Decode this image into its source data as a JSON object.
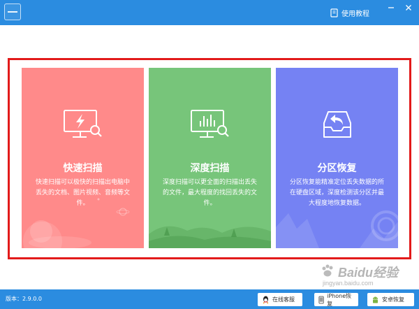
{
  "titlebar": {
    "tutorial_label": "使用教程",
    "icons": [
      "app-logo",
      "book-icon",
      "minimize-icon",
      "close-icon"
    ]
  },
  "cards": [
    {
      "title": "快速扫描",
      "description": "快速扫描可以极快的扫描出电脑中丢失的文档、图片视频、音频等文件。",
      "icon": "monitor-lightning-search-icon",
      "color": "#ff8a8a"
    },
    {
      "title": "深度扫描",
      "description": "深度扫描可以更全面的扫描出丢失的文件，最大程度的找回丢失的文件。",
      "icon": "monitor-chart-search-icon",
      "color": "#77c57a"
    },
    {
      "title": "分区恢复",
      "description": "分区恢复能精准定位丢失数据的所在硬盘区域，深度检测该分区并最大程度地恢复数据。",
      "icon": "tray-return-icon",
      "color": "#7582f3"
    }
  ],
  "bottombar": {
    "version": "版本：2.9.0.0",
    "buttons": [
      {
        "label": "在线客服",
        "icon": "qq-icon"
      },
      {
        "label": "iPhone恢复",
        "icon": "iphone-icon"
      },
      {
        "label": "安卓恢复",
        "icon": "android-icon"
      }
    ]
  },
  "watermark": {
    "text": "Baidu经验",
    "sub": "jingyan.baidu.com"
  },
  "colors": {
    "titlebar": "#2b8ce0",
    "highlight_frame": "#e21a1a"
  }
}
